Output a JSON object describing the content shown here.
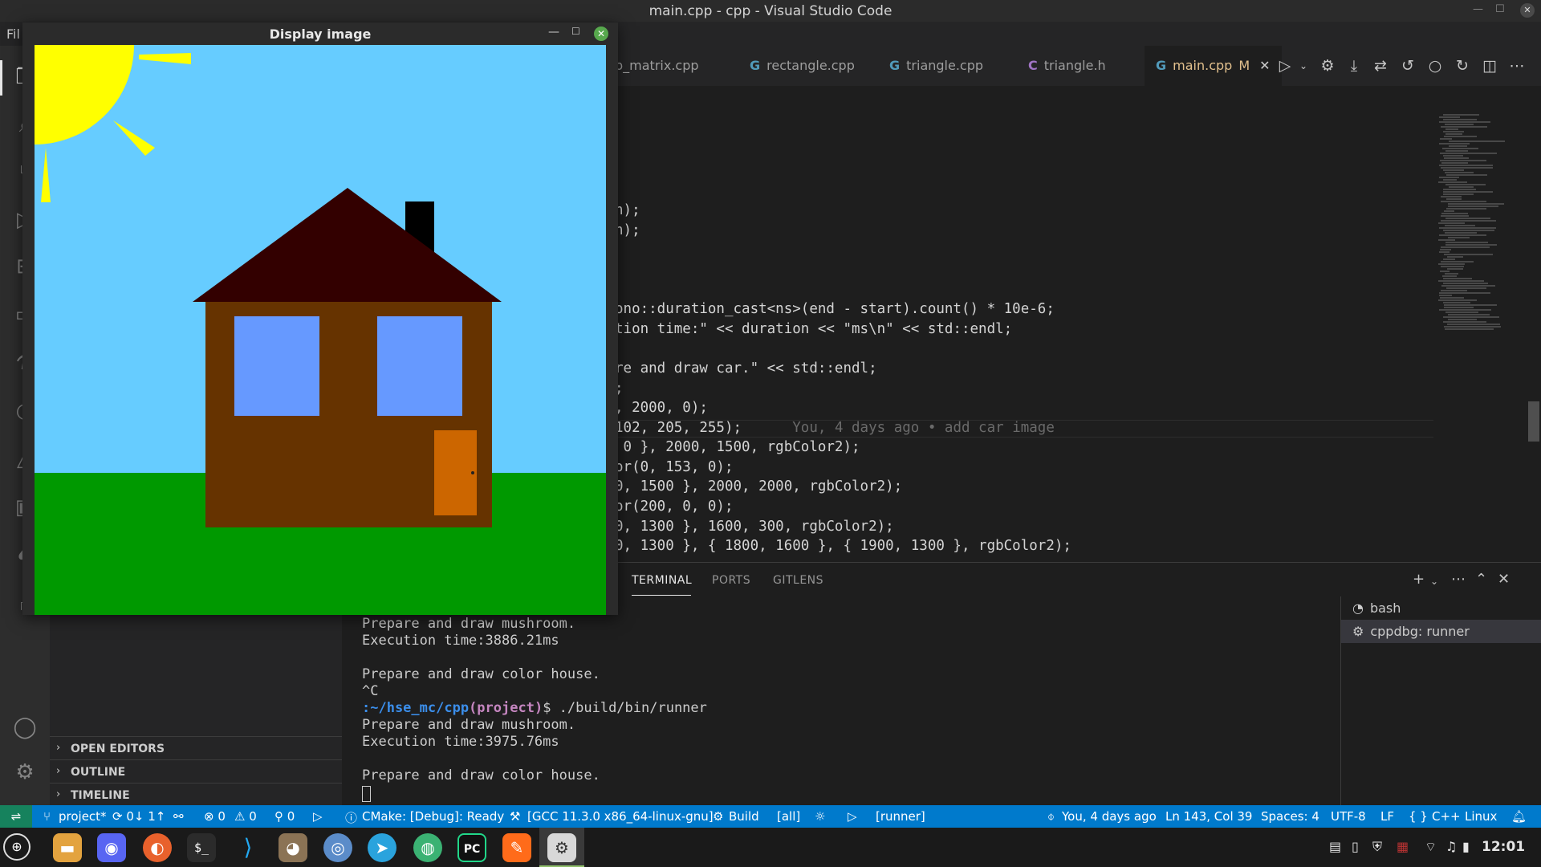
{
  "os": {
    "window_title": "main.cpp - cpp - Visual Studio Code",
    "close_symbol": "✕"
  },
  "menu": {
    "file_partial": "Fil"
  },
  "tabs": [
    {
      "label": "b_matrix.cpp",
      "icon": "cpp-icon"
    },
    {
      "label": "rectangle.cpp",
      "icon": "cpp-icon"
    },
    {
      "label": "triangle.cpp",
      "icon": "cpp-icon"
    },
    {
      "label": "triangle.h",
      "icon": "c-icon"
    },
    {
      "label": "main.cpp",
      "icon": "cpp-icon",
      "modified": "M",
      "active": true
    }
  ],
  "tab_icons": {
    "cpp": "G",
    "c": "C",
    "close": "✕"
  },
  "sidebar": {
    "sections": [
      {
        "label": "OPEN EDITORS"
      },
      {
        "label": "OUTLINE"
      },
      {
        "label": "TIMELINE"
      }
    ]
  },
  "editor": {
    "lines": [
      "h);",
      "h);",
      "ono::duration_cast<ns>(end - start).count() * 10e-6;",
      "tion time:\" << duration << \"ms\\n\" << std::endl;",
      "re and draw car.\" << std::endl;",
      ";",
      ", 2000, 0);",
      "102, 205, 255);",
      " 0 }, 2000, 1500, rgbColor2);",
      "or(0, 153, 0);",
      "0, 1500 }, 2000, 2000, rgbColor2);",
      "or(200, 0, 0);",
      "0, 1300 }, 1600, 300, rgbColor2);",
      "0, 1300 }, { 1800, 1600 }, { 1900, 1300 }, rgbColor2);"
    ],
    "blame": "You, 4 days ago • add car image"
  },
  "panel": {
    "tabs": [
      "TERMINAL",
      "PORTS",
      "GITLENS"
    ],
    "terminal_lines": [
      "Prepare and draw mushroom.",
      "Execution time:3886.21ms",
      "",
      "Prepare and draw color house.",
      "^C"
    ],
    "prompt_path": ":~/hse_mc/cpp",
    "prompt_project": "(project)",
    "prompt_command": "$ ./build/bin/runner",
    "terminal_lines_after": [
      "Prepare and draw mushroom.",
      "Execution time:3975.76ms",
      "",
      "Prepare and draw color house."
    ],
    "terminals": [
      {
        "label": "bash"
      },
      {
        "label": "cppdbg: runner",
        "selected": true
      }
    ]
  },
  "statusbar": {
    "remote": "⇌",
    "branch": "project*",
    "sync": "⟳ 0↓ 1↑",
    "errors": "⊗ 0",
    "warnings": "⚠ 0",
    "ports": "⚲ 0",
    "cmake": "CMake: [Debug]: Ready",
    "kit": "[GCC 11.3.0 x86_64-linux-gnu]",
    "build": "Build",
    "target": "[all]",
    "launch_target": "[runner]",
    "blame": "You, 4 days ago",
    "position": "Ln 143, Col 39",
    "spaces": "Spaces: 4",
    "encoding": "UTF-8",
    "eol": "LF",
    "language": "C++",
    "os": "Linux"
  },
  "taskbar": {
    "clock": "12:01",
    "apps": [
      "files",
      "discord",
      "firefox",
      "terminal",
      "vscode",
      "bear",
      "chromium",
      "telegram",
      "browser",
      "pycharm",
      "sublime",
      "settings"
    ]
  },
  "image_window": {
    "title": "Display image",
    "colors": {
      "sky": "#66ccff",
      "grass": "#009900",
      "sun": "#ffff00",
      "roof": "#330000",
      "chimney": "#000000",
      "wall": "#663300",
      "window": "#6699ff",
      "door": "#cc6600"
    }
  }
}
